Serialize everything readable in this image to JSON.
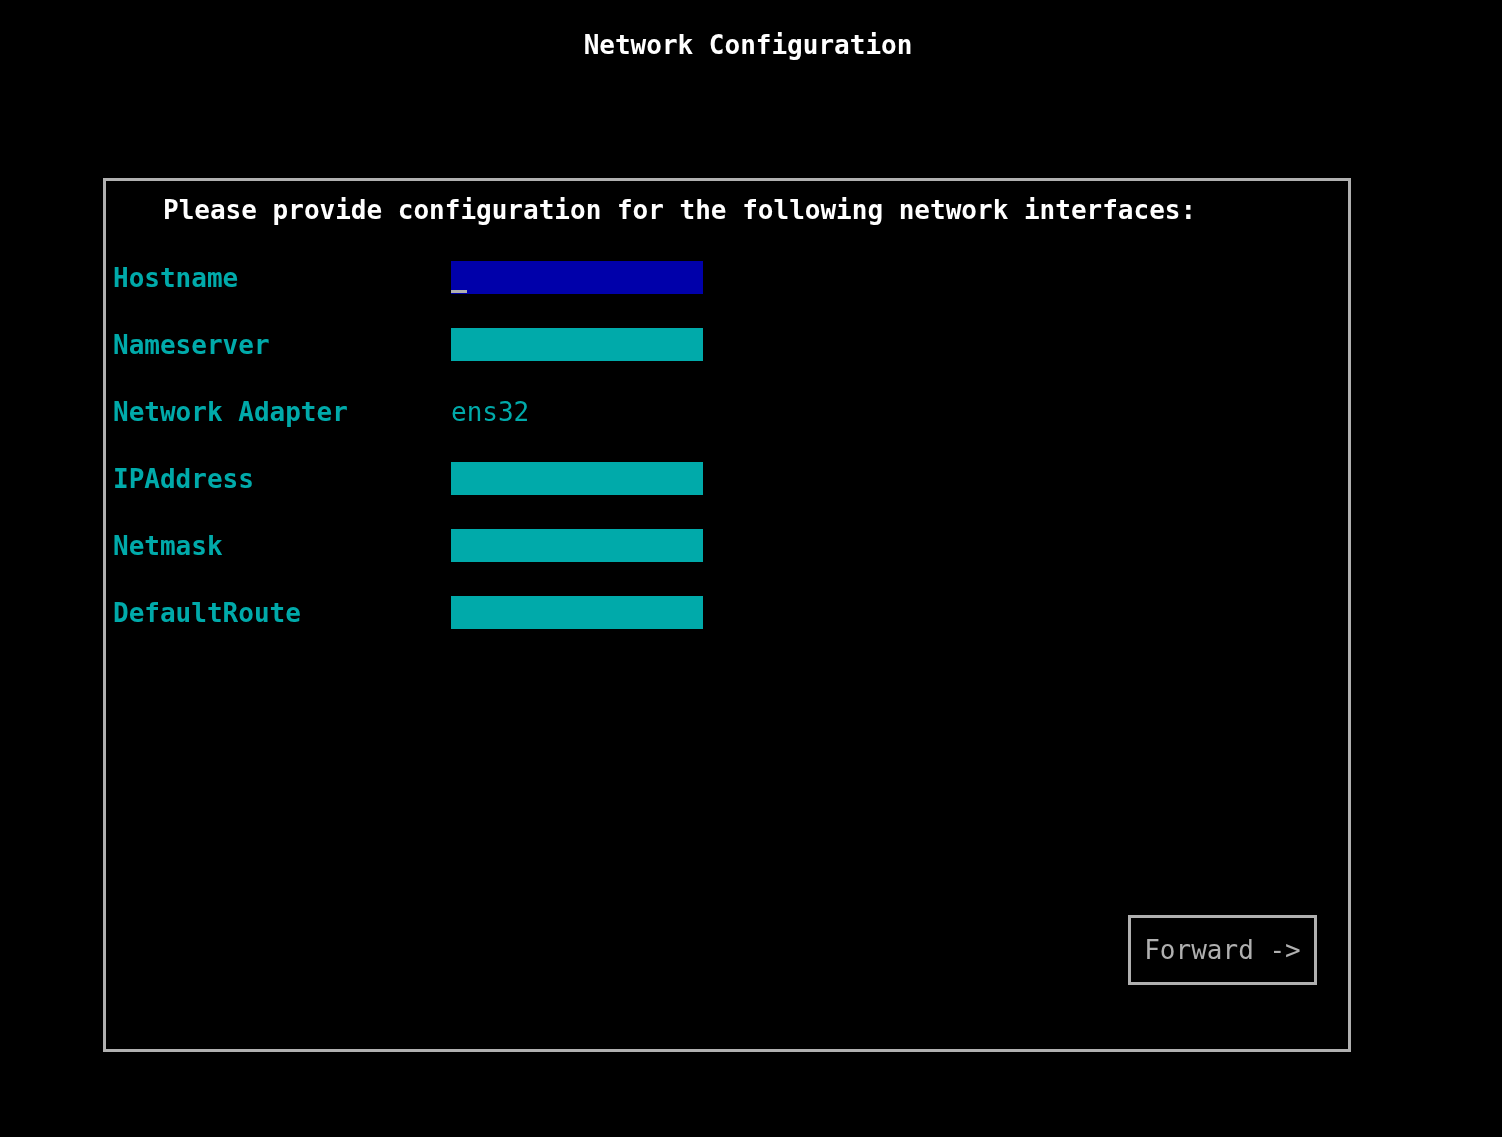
{
  "title": "Network Configuration",
  "prompt": "Please provide configuration for the following network interfaces:",
  "fields": [
    {
      "label": "Hostname",
      "kind": "input",
      "selected": true
    },
    {
      "label": "Nameserver",
      "kind": "input",
      "selected": false
    },
    {
      "label": "Network Adapter",
      "kind": "static",
      "value": "ens32",
      "selected": false
    },
    {
      "label": "IPAddress",
      "kind": "input",
      "selected": false
    },
    {
      "label": "Netmask",
      "kind": "input",
      "selected": false
    },
    {
      "label": "DefaultRoute",
      "kind": "input",
      "selected": false
    }
  ],
  "forward_button": "Forward ->"
}
